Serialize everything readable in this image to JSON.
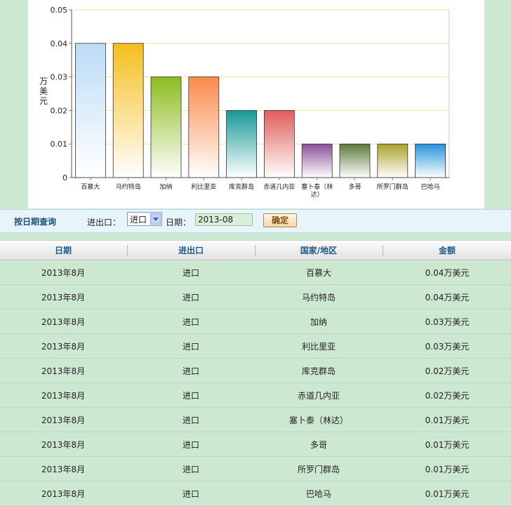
{
  "chart_data": {
    "type": "bar",
    "categories": [
      "百慕大",
      "马约特岛",
      "加纳",
      "利比里亚",
      "库克群岛",
      "赤道几内亚",
      "塞卜泰（林达）",
      "多哥",
      "所罗门群岛",
      "巴哈马"
    ],
    "values": [
      0.04,
      0.04,
      0.03,
      0.03,
      0.02,
      0.02,
      0.01,
      0.01,
      0.01,
      0.01
    ],
    "ylabel": "万美元",
    "ylim": [
      0,
      0.05
    ],
    "yticks": [
      "0",
      "0.01",
      "0.02",
      "0.03",
      "0.04",
      "0.05"
    ],
    "grid": true,
    "colors": [
      "#bcdcf6",
      "#f5be1e",
      "#8cbc1e",
      "#fb8a4a",
      "#169a96",
      "#e05c5c",
      "#8c4f9a",
      "#5a7c38",
      "#aaa22a",
      "#2592dc"
    ]
  },
  "query": {
    "title": "按日期查询",
    "io_label": "进出口：",
    "io_value": "进口",
    "date_label": "日期：",
    "date_value": "2013-08",
    "ok_label": "确定"
  },
  "table": {
    "headers": [
      "日期",
      "进出口",
      "国家/地区",
      "金额"
    ],
    "rows": [
      [
        "2013年8月",
        "进口",
        "百慕大",
        "0.04万美元"
      ],
      [
        "2013年8月",
        "进口",
        "马约特岛",
        "0.04万美元"
      ],
      [
        "2013年8月",
        "进口",
        "加纳",
        "0.03万美元"
      ],
      [
        "2013年8月",
        "进口",
        "利比里亚",
        "0.03万美元"
      ],
      [
        "2013年8月",
        "进口",
        "库克群岛",
        "0.02万美元"
      ],
      [
        "2013年8月",
        "进口",
        "赤道几内亚",
        "0.02万美元"
      ],
      [
        "2013年8月",
        "进口",
        "塞卜泰（林达）",
        "0.01万美元"
      ],
      [
        "2013年8月",
        "进口",
        "多哥",
        "0.01万美元"
      ],
      [
        "2013年8月",
        "进口",
        "所罗门群岛",
        "0.01万美元"
      ],
      [
        "2013年8月",
        "进口",
        "巴哈马",
        "0.01万美元"
      ]
    ]
  }
}
